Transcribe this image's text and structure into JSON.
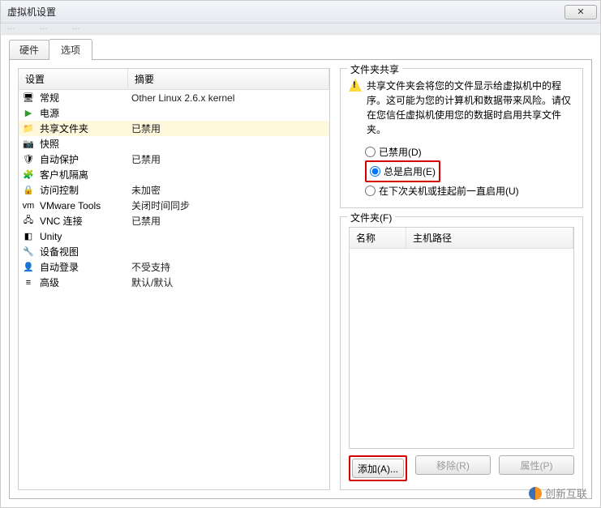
{
  "window": {
    "title": "虚拟机设置"
  },
  "tabs": {
    "hardware": "硬件",
    "options": "选项"
  },
  "columns": {
    "settings": "设置",
    "summary": "摘要"
  },
  "settings_items": [
    {
      "icon": "monitor-icon",
      "name": "常规",
      "summary": "Other Linux 2.6.x kernel"
    },
    {
      "icon": "play-icon",
      "name": "电源",
      "summary": ""
    },
    {
      "icon": "folder-icon",
      "name": "共享文件夹",
      "summary": "已禁用",
      "selected": true
    },
    {
      "icon": "camera-icon",
      "name": "快照",
      "summary": ""
    },
    {
      "icon": "shield-icon",
      "name": "自动保护",
      "summary": "已禁用"
    },
    {
      "icon": "isolate-icon",
      "name": "客户机隔离",
      "summary": ""
    },
    {
      "icon": "lock-icon",
      "name": "访问控制",
      "summary": "未加密"
    },
    {
      "icon": "vm-icon",
      "name": "VMware Tools",
      "summary": "关闭时间同步"
    },
    {
      "icon": "vnc-icon",
      "name": "VNC 连接",
      "summary": "已禁用"
    },
    {
      "icon": "unity-icon",
      "name": "Unity",
      "summary": ""
    },
    {
      "icon": "device-icon",
      "name": "设备视图",
      "summary": ""
    },
    {
      "icon": "login-icon",
      "name": "自动登录",
      "summary": "不受支持"
    },
    {
      "icon": "advanced-icon",
      "name": "高级",
      "summary": "默认/默认"
    }
  ],
  "share": {
    "group_label": "文件夹共享",
    "warning": "共享文件夹会将您的文件显示给虚拟机中的程序。这可能为您的计算机和数据带来风险。请仅在您信任虚拟机使用您的数据时启用共享文件夹。",
    "radio_disabled": "已禁用(D)",
    "radio_always": "总是启用(E)",
    "radio_until": "在下次关机或挂起前一直启用(U)"
  },
  "folders": {
    "group_label": "文件夹(F)",
    "col_name": "名称",
    "col_host": "主机路径",
    "btn_add": "添加(A)...",
    "btn_remove": "移除(R)",
    "btn_props": "属性(P)"
  },
  "watermark": "创新互联"
}
